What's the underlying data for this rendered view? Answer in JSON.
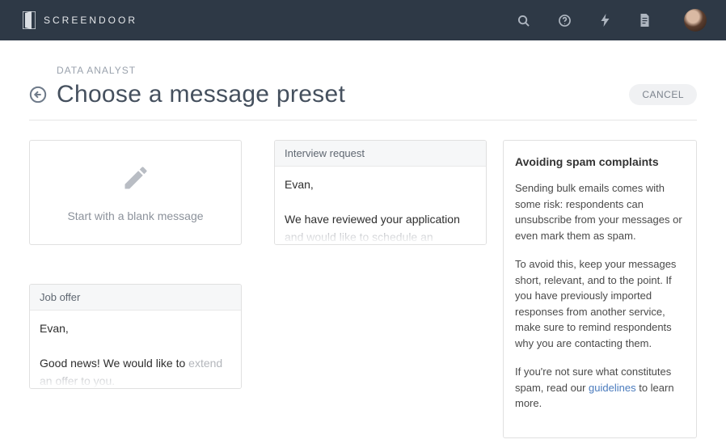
{
  "brand": {
    "name": "SCREENDOOR"
  },
  "breadcrumb": "DATA ANALYST",
  "title": "Choose a message preset",
  "cancel_label": "CANCEL",
  "blank_label": "Start with a blank message",
  "presets": {
    "interview": {
      "title": "Interview request",
      "greeting": "Evan,",
      "line1": "We have reviewed your application",
      "line2_fade": "and would like to schedule an"
    },
    "offer": {
      "title": "Job offer",
      "greeting": "Evan,",
      "line1": "Good news! We would like to",
      "line2_fade": "extend an offer to you."
    }
  },
  "sidebar": {
    "heading": "Avoiding spam complaints",
    "p1": "Sending bulk emails comes with some risk: respondents can unsubscribe from your messages or even mark them as spam.",
    "p2": "To avoid this, keep your messages short, relevant, and to the point. If you have previously imported responses from another service, make sure to remind respondents why you are contacting them.",
    "p3_pre": "If you're not sure what constitutes spam, read our ",
    "p3_link": "guidelines",
    "p3_post": " to learn more."
  }
}
